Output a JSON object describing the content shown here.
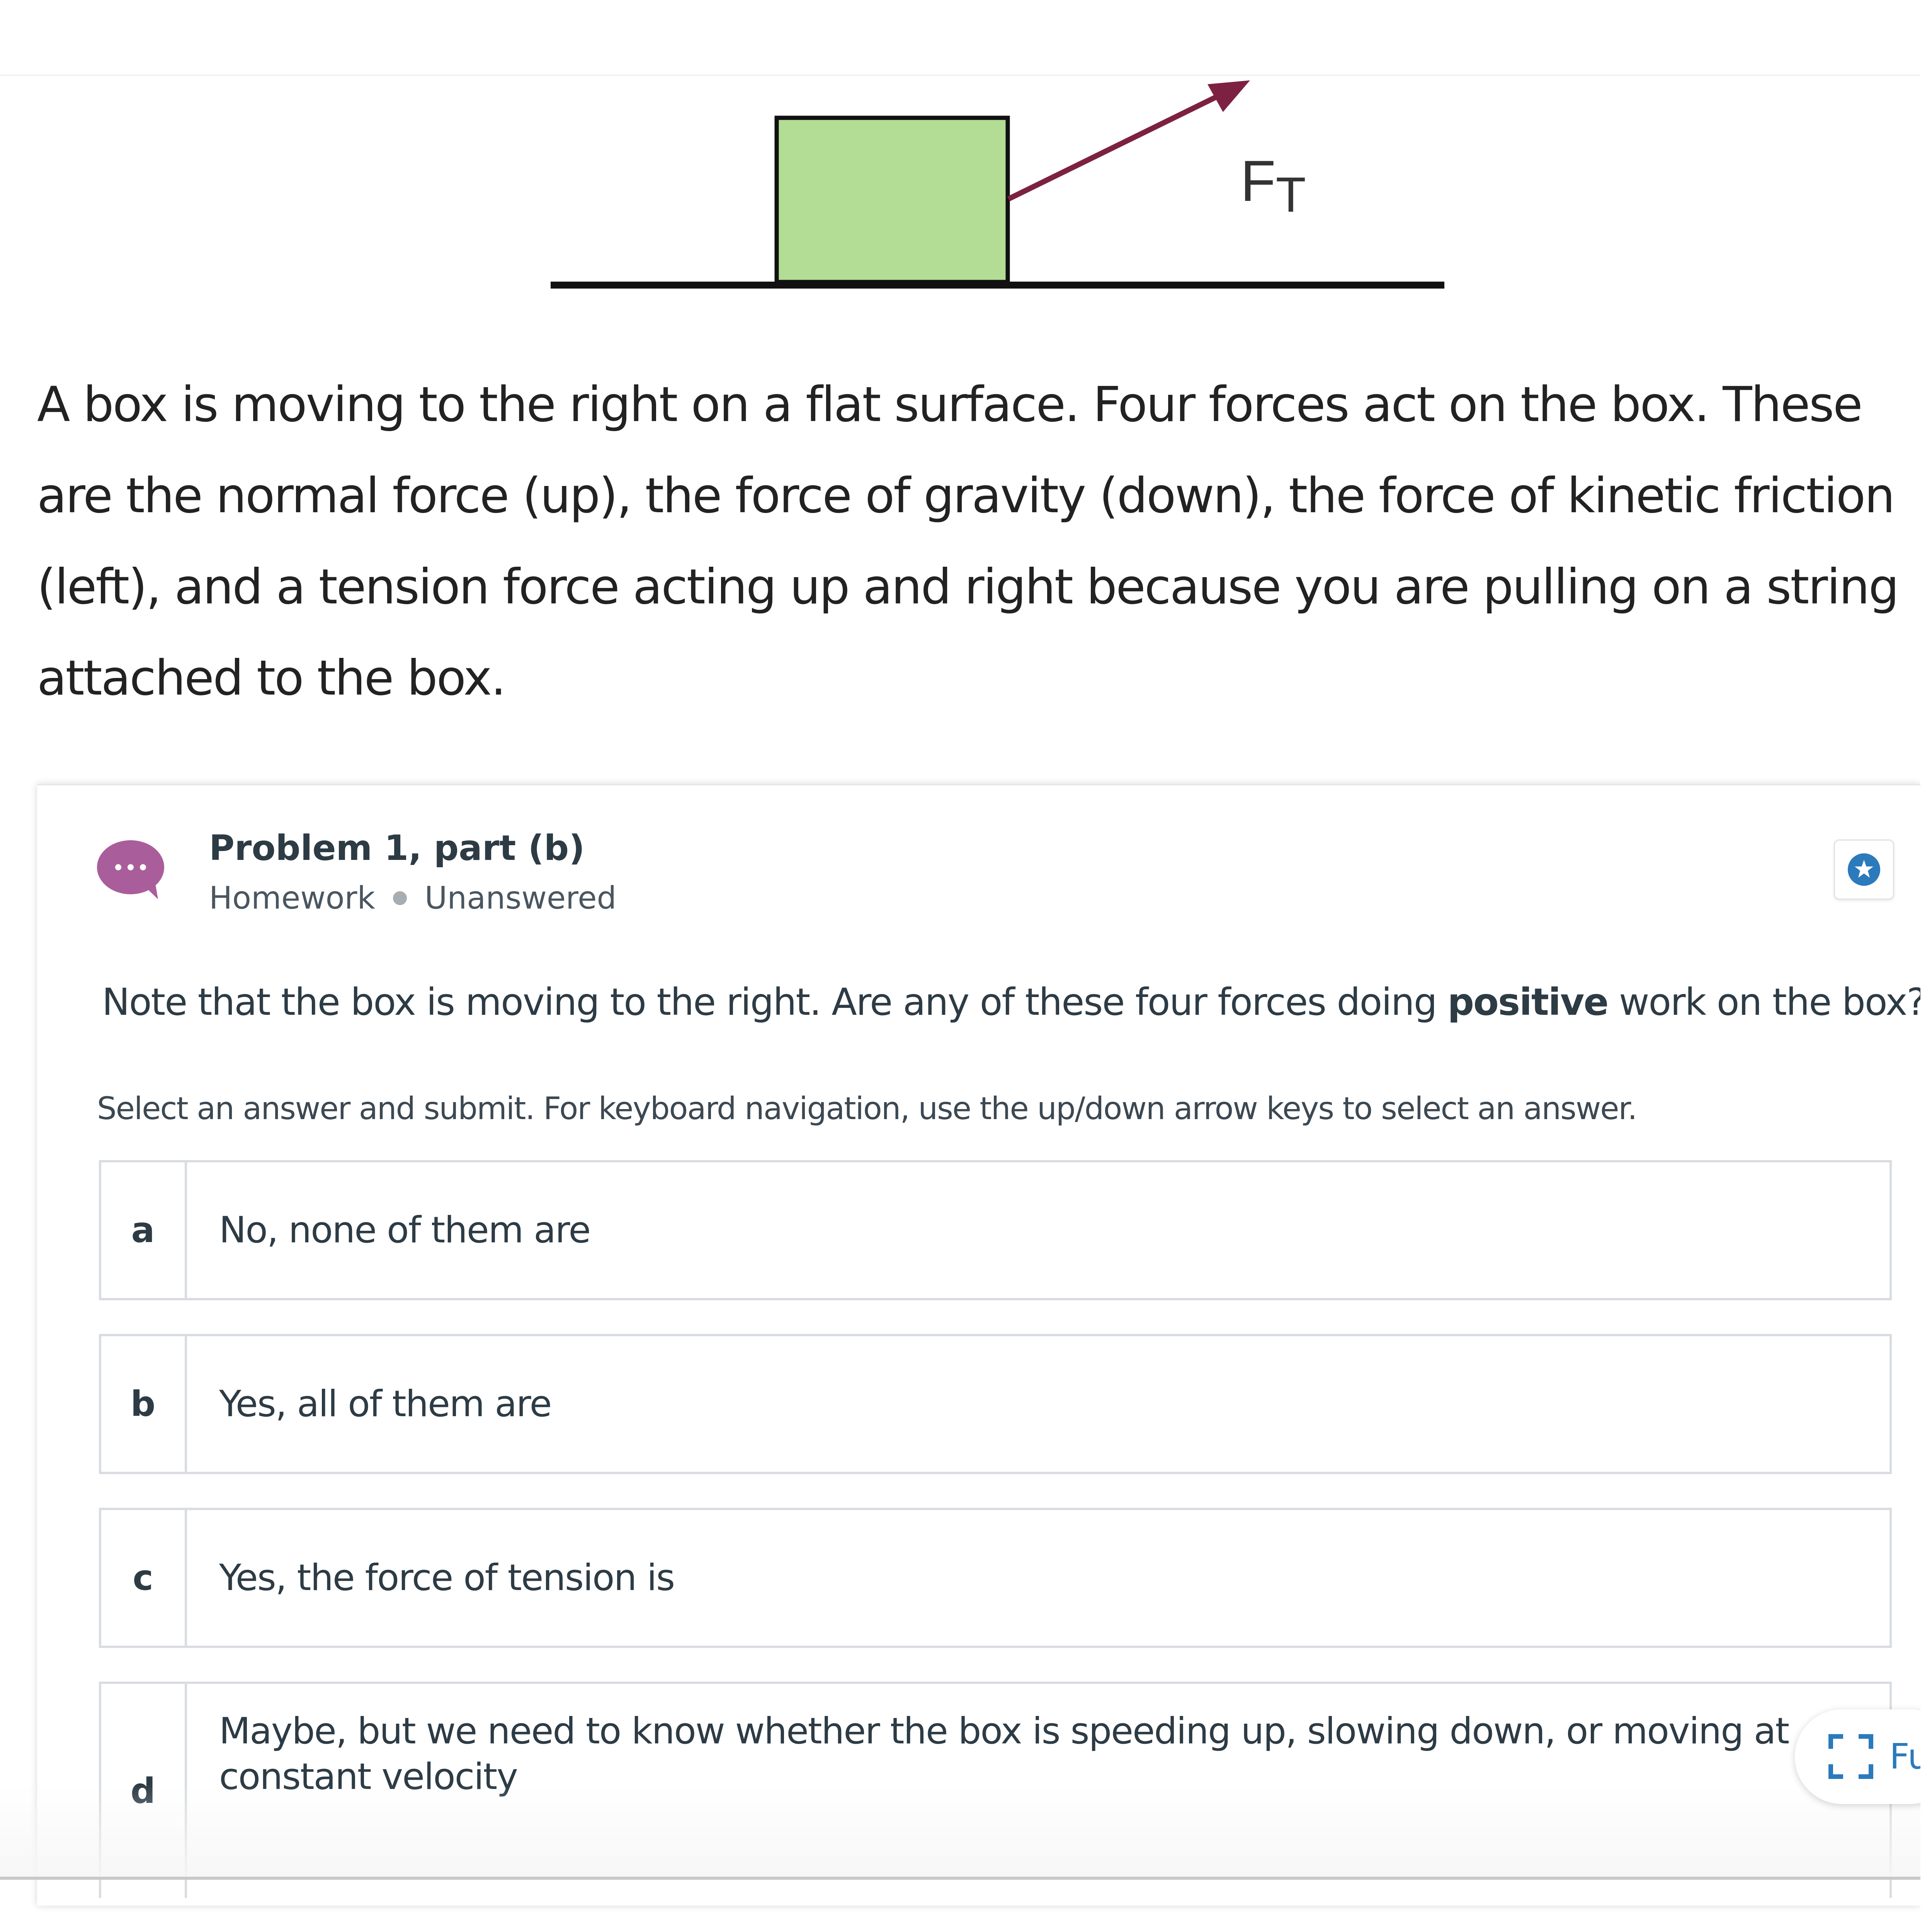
{
  "diagram": {
    "force_label": "F",
    "force_subscript": "T",
    "box_color": "#b3dd94",
    "arrow_color": "#7c2141"
  },
  "intro_text": "A box is moving to the right on a flat surface. Four forces act on the box. These are the normal force (up), the force of gravity (down), the force of kinetic friction (left), and a tension force acting up and right because you are pulling on a string attached to the box.",
  "card": {
    "icon": "discussion-bubble-icon",
    "icon_color": "#a95e9b",
    "title": "Problem 1, part (b)",
    "type": "Homework",
    "status": "Unanswered",
    "bookmark_icon": "star-icon",
    "accent_color": "#2b7abc",
    "question_before": "Note that the box is moving to the right. Are any of these four forces doing ",
    "question_bold": "positive",
    "question_after": " work on the box?",
    "instructions": "Select an answer and submit. For keyboard navigation, use the up/down arrow keys to select an answer.",
    "options": [
      {
        "letter": "a",
        "text": "No, none of them are"
      },
      {
        "letter": "b",
        "text": "Yes, all of them are"
      },
      {
        "letter": "c",
        "text": "Yes, the force of tension is"
      },
      {
        "letter": "d",
        "text": "Maybe, but we need to know whether the box is speeding up, slowing down, or moving at constant velocity"
      }
    ]
  },
  "fullscreen": {
    "icon": "fullscreen-icon",
    "label": "Fu"
  }
}
